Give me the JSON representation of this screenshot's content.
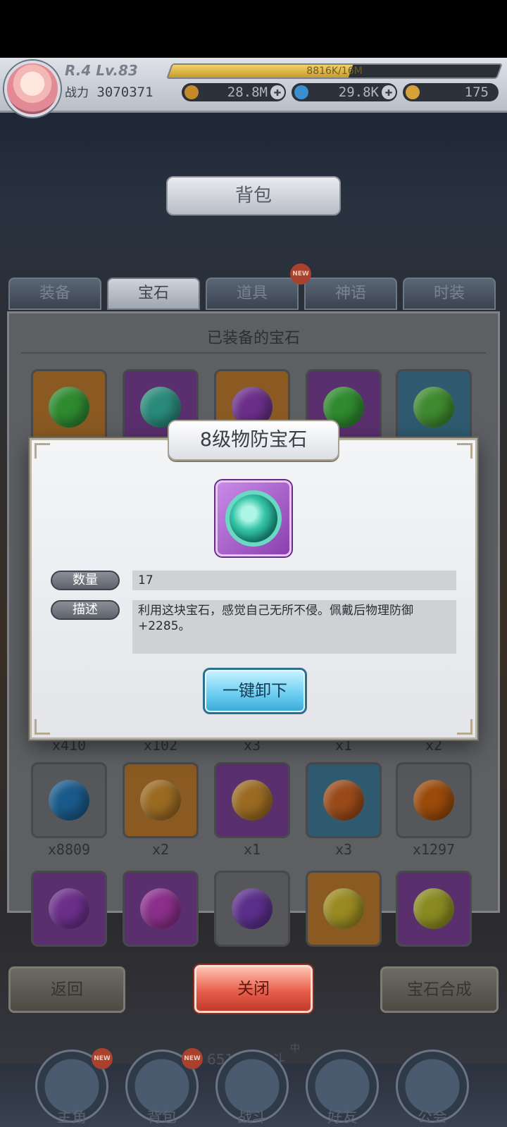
{
  "hud": {
    "rank": "R.4 Lv.83",
    "exp_text": "8816K/16M",
    "exp_fraction": 0.55,
    "power_label": "战力",
    "power_value": "3070371",
    "gold": "28.8M",
    "diamond": "29.8K",
    "ticket": "175",
    "plus": "✚"
  },
  "page_title": "背包",
  "tabs": [
    {
      "label": "装备",
      "active": false
    },
    {
      "label": "宝石",
      "active": true
    },
    {
      "label": "道具",
      "active": false,
      "badge": "NEW"
    },
    {
      "label": "神语",
      "active": false
    },
    {
      "label": "时装",
      "active": false
    }
  ],
  "bag": {
    "section_title": "已装备的宝石",
    "equipped_gems": [
      {
        "frame": "#8a5a22",
        "gem": "#2f8a30"
      },
      {
        "frame": "#5a2f6e",
        "gem": "#2a8a7a"
      },
      {
        "frame": "#8a5a22",
        "gem": "#6b2f8a"
      },
      {
        "frame": "#5a2f6e",
        "gem": "#2f8a30"
      },
      {
        "frame": "#2f5a70",
        "gem": "#3f8a2f"
      }
    ],
    "row_behind_quantities": [
      "x410",
      "x102",
      "x3",
      "x1",
      "x2"
    ],
    "row2": [
      {
        "frame": "#55575b",
        "gem": "#1a5a8a",
        "qty": "x8809"
      },
      {
        "frame": "#8a5a22",
        "gem": "#9a6a22",
        "qty": "x2"
      },
      {
        "frame": "#5a2f6e",
        "gem": "#9a6a22",
        "qty": "x1"
      },
      {
        "frame": "#2f5a70",
        "gem": "#9a4a1a",
        "qty": "x3"
      },
      {
        "frame": "#55575b",
        "gem": "#9a4a0a",
        "qty": "x1297"
      }
    ],
    "row3": [
      {
        "frame": "#5a2f6e",
        "gem": "#6b2f8a"
      },
      {
        "frame": "#5a2f6e",
        "gem": "#8a2f8a"
      },
      {
        "frame": "#55575b",
        "gem": "#5a2f8a"
      },
      {
        "frame": "#8a5a22",
        "gem": "#9a8a22"
      },
      {
        "frame": "#5a2f6e",
        "gem": "#8a8a22"
      }
    ]
  },
  "modal": {
    "title": "8级物防宝石",
    "quantity_label": "数量",
    "quantity_value": "17",
    "description_label": "描述",
    "description_value": "利用这块宝石，感觉自己无所不侵。佩戴后物理防御+2285。",
    "unequip_button": "一键卸下",
    "gem_icon": "teal-octagon-gem-icon"
  },
  "bottom_buttons": {
    "back": "返回",
    "close": "关闭",
    "synthesize": "宝石合成"
  },
  "nav": {
    "stage_text": "6511层战斗",
    "stage_sub": "中",
    "items": [
      {
        "label": "主角",
        "badge": "NEW"
      },
      {
        "label": "背包",
        "badge": "NEW"
      },
      {
        "label": "战斗"
      },
      {
        "label": "好友"
      },
      {
        "label": "公会"
      }
    ]
  },
  "colors": {
    "accent_blue": "#6fd0f2",
    "close_red": "#e85f4b",
    "gem_teal": "#37c4a6",
    "gem_frame_purple": "#8a3fb0"
  }
}
